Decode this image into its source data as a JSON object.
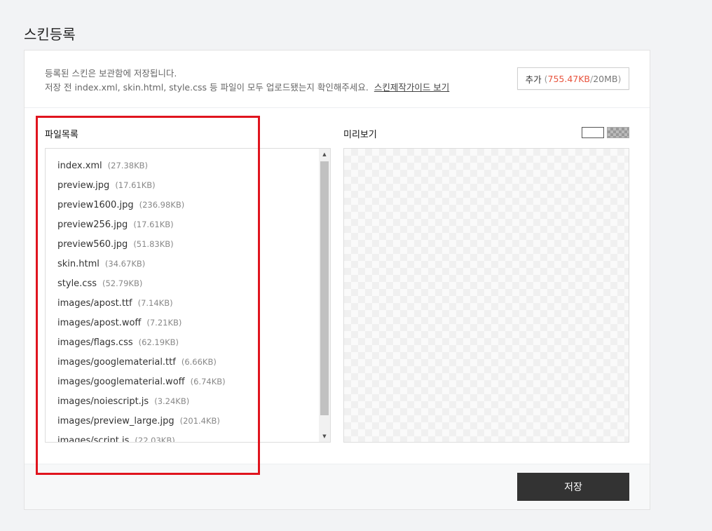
{
  "page": {
    "title": "스킨등록"
  },
  "notice": {
    "line1": "등록된 스킨은 보관함에 저장됩니다.",
    "line2": "저장 전 index.xml, skin.html, style.css 등 파일이 모두 업로드됐는지 확인해주세요.",
    "guide_link": "스킨제작가이드 보기"
  },
  "add_button": {
    "label": "추가",
    "paren_open": "(",
    "used": "755.47KB",
    "sep": "/",
    "max": "20MB",
    "paren_close": ")"
  },
  "file_list": {
    "label": "파일목록",
    "items": [
      {
        "name": "index.xml",
        "size": "(27.38KB)"
      },
      {
        "name": "preview.jpg",
        "size": "(17.61KB)"
      },
      {
        "name": "preview1600.jpg",
        "size": "(236.98KB)"
      },
      {
        "name": "preview256.jpg",
        "size": "(17.61KB)"
      },
      {
        "name": "preview560.jpg",
        "size": "(51.83KB)"
      },
      {
        "name": "skin.html",
        "size": "(34.67KB)"
      },
      {
        "name": "style.css",
        "size": "(52.79KB)"
      },
      {
        "name": "images/apost.ttf",
        "size": "(7.14KB)"
      },
      {
        "name": "images/apost.woff",
        "size": "(7.21KB)"
      },
      {
        "name": "images/flags.css",
        "size": "(62.19KB)"
      },
      {
        "name": "images/googlematerial.ttf",
        "size": "(6.66KB)"
      },
      {
        "name": "images/googlematerial.woff",
        "size": "(6.74KB)"
      },
      {
        "name": "images/noiescript.js",
        "size": "(3.24KB)"
      },
      {
        "name": "images/preview_large.jpg",
        "size": "(201.4KB)"
      },
      {
        "name": "images/script.js",
        "size": "(22.03KB)"
      }
    ]
  },
  "preview": {
    "label": "미리보기"
  },
  "footer": {
    "save_label": "저장"
  },
  "icons": {
    "scroll_up": "scroll-up-arrow-icon",
    "scroll_down": "scroll-down-arrow-icon"
  },
  "colors": {
    "accent_used_size": "#e8543e",
    "save_button_bg": "#333333",
    "highlight_border": "#e0141e"
  }
}
